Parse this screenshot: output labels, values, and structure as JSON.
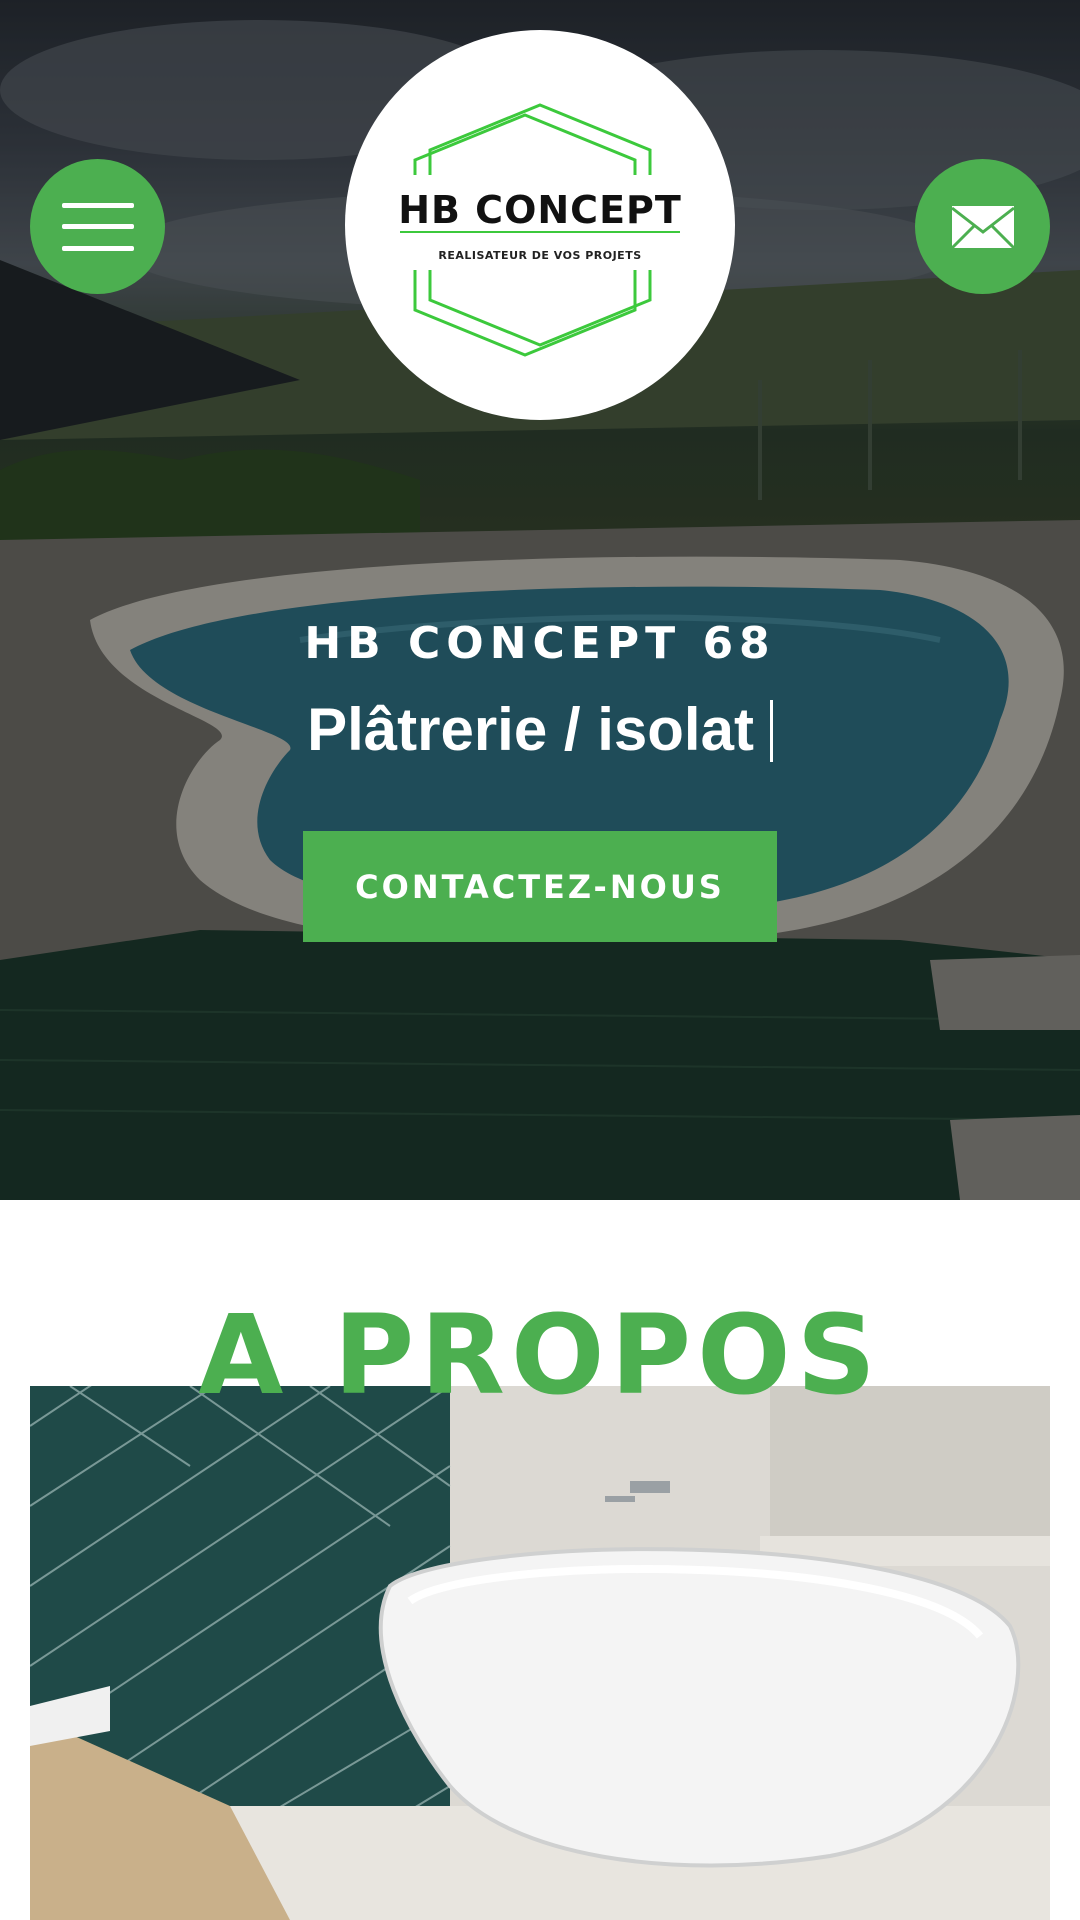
{
  "header": {
    "logo": {
      "title": "HB CONCEPT",
      "tagline": "REALISATEUR DE VOS PROJETS"
    },
    "menu_icon": "hamburger-menu-icon",
    "mail_icon": "envelope-icon"
  },
  "hero": {
    "subtitle": "HB CONCEPT 68",
    "typed_text": "Plâtrerie / isolat",
    "cta_label": "CONTACTEZ-NOUS"
  },
  "about": {
    "title": "A PROPOS"
  },
  "colors": {
    "accent": "#4caf50",
    "text_light": "#ffffff",
    "background": "#ffffff"
  }
}
